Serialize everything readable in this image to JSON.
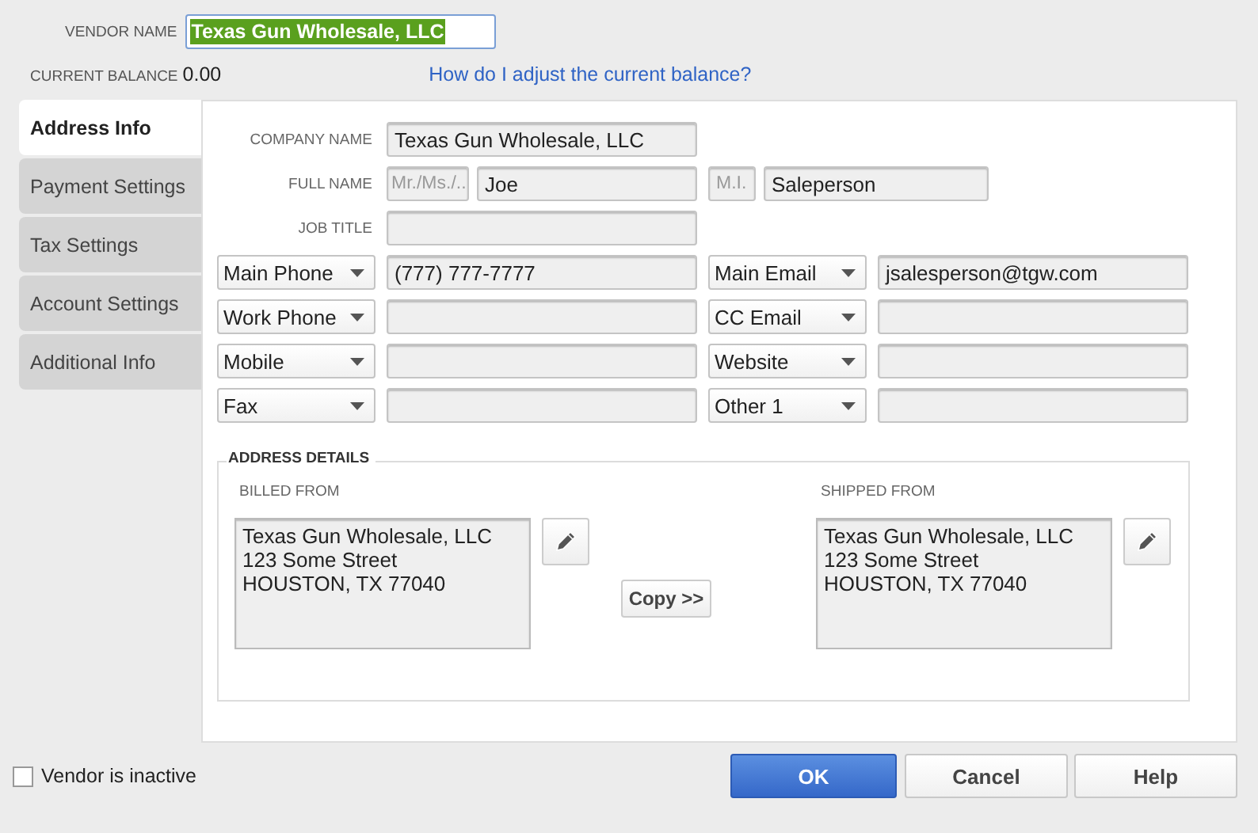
{
  "vendor_name": {
    "label": "VENDOR NAME",
    "value": "Texas Gun Wholesale, LLC",
    "highlighted": true
  },
  "current_balance": {
    "label": "CURRENT BALANCE",
    "value": "0.00"
  },
  "help_link": "How do I adjust the current balance?",
  "tabs": [
    {
      "label": "Address Info",
      "selected": true
    },
    {
      "label": "Payment Settings",
      "selected": false
    },
    {
      "label": "Tax Settings",
      "selected": false
    },
    {
      "label": "Account Settings",
      "selected": false
    },
    {
      "label": "Additional Info",
      "selected": false
    }
  ],
  "company_name": {
    "label": "COMPANY NAME",
    "value": "Texas Gun Wholesale, LLC"
  },
  "full_name": {
    "label": "FULL NAME",
    "title_placeholder": "Mr./Ms./..",
    "first": "Joe",
    "middle_placeholder": "M.I.",
    "last": "Saleperson"
  },
  "job_title": {
    "label": "JOB TITLE"
  },
  "contacts": [
    {
      "left_type": "Main Phone",
      "left_value": "(777) 777-7777",
      "right_type": "Main Email",
      "right_value": "jsalesperson@tgw.com"
    },
    {
      "left_type": "Work Phone",
      "right_type": "CC Email"
    },
    {
      "left_type": "Mobile",
      "right_type": "Website"
    },
    {
      "left_type": "Fax",
      "right_type": "Other 1"
    }
  ],
  "address_details": {
    "title": "ADDRESS DETAILS",
    "billed": {
      "label": "BILLED FROM",
      "address": "Texas Gun Wholesale, LLC\n123 Some Street\nHOUSTON, TX 77040"
    },
    "copy_button": "Copy >>",
    "shipped": {
      "label": "SHIPPED FROM",
      "address": "Texas Gun Wholesale, LLC\n123 Some Street\nHOUSTON, TX 77040"
    }
  },
  "inactive": {
    "label": "Vendor is inactive",
    "checked": false
  },
  "buttons": [
    {
      "label": "OK",
      "kind": "primary"
    },
    {
      "label": "Cancel",
      "kind": "normal"
    },
    {
      "label": "Help",
      "kind": "normal"
    }
  ]
}
